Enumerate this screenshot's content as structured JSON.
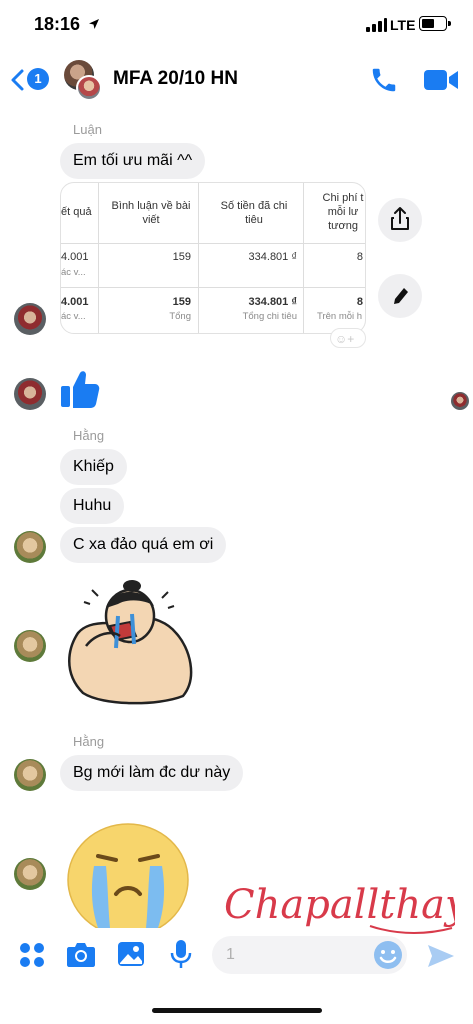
{
  "status_bar": {
    "time": "18:16",
    "carrier": "LTE"
  },
  "header": {
    "unread_count": "1",
    "title": "MFA 20/10 HN"
  },
  "messages": {
    "luan_name": "Luận",
    "luan_text": "Em tối ưu mãi ^^",
    "hang_name_1": "Hằng",
    "hang_text_1": "Khiếp",
    "hang_text_2": "Huhu",
    "hang_text_3": "C xa đảo quá em ơi",
    "hang_name_2": "Hằng",
    "hang_text_4": "Bg mới làm đc dư này"
  },
  "table": {
    "col_heads": [
      "ết quả",
      "Bình luận về bài viết",
      "Số tiền đã chi tiêu",
      "Chi phí t mỗi lư tương"
    ],
    "row1": [
      "4.001",
      "ác v...",
      "159",
      "334.801 ₫",
      "8"
    ],
    "row2": [
      "4.001",
      "ác v...",
      "159",
      "Tổng",
      "334.801 ₫",
      "Tổng chi tiêu",
      "8",
      "Trên mỗi h"
    ]
  },
  "composer": {
    "placeholder": "1"
  },
  "signature": "Chapallthay",
  "colors": {
    "accent": "#1a7cf2",
    "bubble": "#efeff1",
    "signature": "#d83a4a"
  }
}
